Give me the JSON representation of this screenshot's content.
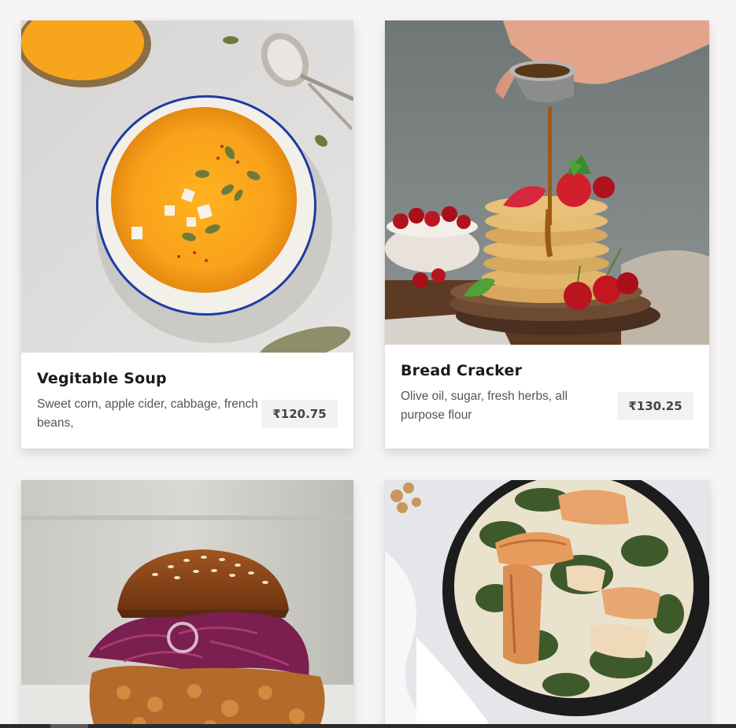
{
  "menu": {
    "items": [
      {
        "name": "Vegitable Soup",
        "description": "Sweet corn, apple cider, cabbage, french beans,",
        "price": "₹120.75",
        "image_icon": "soup-bowl-photo"
      },
      {
        "name": "Bread Cracker",
        "description": "Olive oil, sugar, fresh herbs, all purpose flour",
        "price": "₹130.25",
        "image_icon": "pancake-stack-photo"
      },
      {
        "image_icon": "burger-photo"
      },
      {
        "image_icon": "fish-skillet-photo"
      }
    ]
  },
  "colors": {
    "page_background": "#f6f4f5",
    "card_background": "#ffffff",
    "price_background": "#f2f2f2",
    "title_text": "#1a1a1a",
    "body_text": "#555555"
  }
}
